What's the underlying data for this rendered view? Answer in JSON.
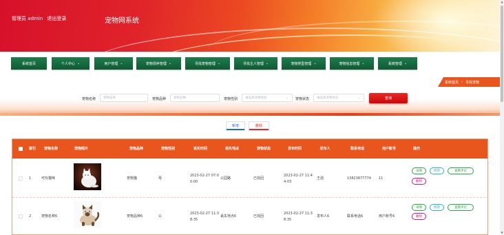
{
  "header": {
    "user_label": "管理员 admin",
    "logout_label": "退出登录",
    "site_title": "宠物网系统"
  },
  "nav": {
    "items": [
      {
        "label": "系统首页",
        "dropdown": false
      },
      {
        "label": "个人中心",
        "dropdown": true
      },
      {
        "label": "用户管理",
        "dropdown": true
      },
      {
        "label": "宠物领养管理",
        "dropdown": true
      },
      {
        "label": "寻找宠物管理",
        "dropdown": true
      },
      {
        "label": "寻找主人管理",
        "dropdown": true
      },
      {
        "label": "宠物类型管理",
        "dropdown": true
      },
      {
        "label": "宠物信息管理",
        "dropdown": true
      },
      {
        "label": "系统管理",
        "dropdown": true
      }
    ]
  },
  "breadcrumb": {
    "home": "系统首页",
    "separator": "›",
    "current": "寻找宠物"
  },
  "search": {
    "name_label": "宠物名称",
    "name_placeholder": "宠物名称",
    "breed_label": "宠物品种",
    "breed_placeholder": "宠物品种",
    "gender_label": "宠物性别",
    "gender_placeholder": "请选择宠物性别",
    "status_label": "宠物状态",
    "status_placeholder": "请选择宠物状态",
    "button_label": "查询"
  },
  "actions": {
    "add_label": "新增",
    "delete_label": "删除"
  },
  "table": {
    "headers": [
      "索引",
      "宠物名称",
      "宠物照片",
      "宠物品种",
      "宠物性别",
      "丢失时间",
      "丢失地点",
      "宠物状态",
      "发布时间",
      "发布人",
      "联系电话",
      "用户账号",
      "操作"
    ],
    "rows": [
      {
        "index": "1",
        "name": "可怜猫咪",
        "photo": "white-cat",
        "breed": "宠物猫",
        "gender": "母",
        "lost_time": "2023-02-27 07:00:00",
        "lost_place": "公园路",
        "status": "已找回",
        "publish_time": "2023-02-27 11:44:03",
        "publisher": "王强",
        "phone": "13823877774",
        "account": "11"
      },
      {
        "index": "2",
        "name": "宠物名称6",
        "photo": "siamese-kitten",
        "breed": "宠物品种6",
        "gender": "公",
        "lost_time": "2023-02-27 11:38:35",
        "lost_place": "丢失地点6",
        "status": "已找回",
        "publish_time": "2023-02-27 11:38:35",
        "publisher": "发布人6",
        "phone": "联系电话6",
        "account": "用户账号6"
      }
    ],
    "row_buttons": {
      "detail": "详情",
      "edit": "修改",
      "review": "查看评论",
      "delete": "删除"
    }
  },
  "colors": {
    "header_red": "#d6102a",
    "nav_green": "#1e7d4c",
    "table_header": "#e8561e",
    "search_button": "#e01818"
  }
}
